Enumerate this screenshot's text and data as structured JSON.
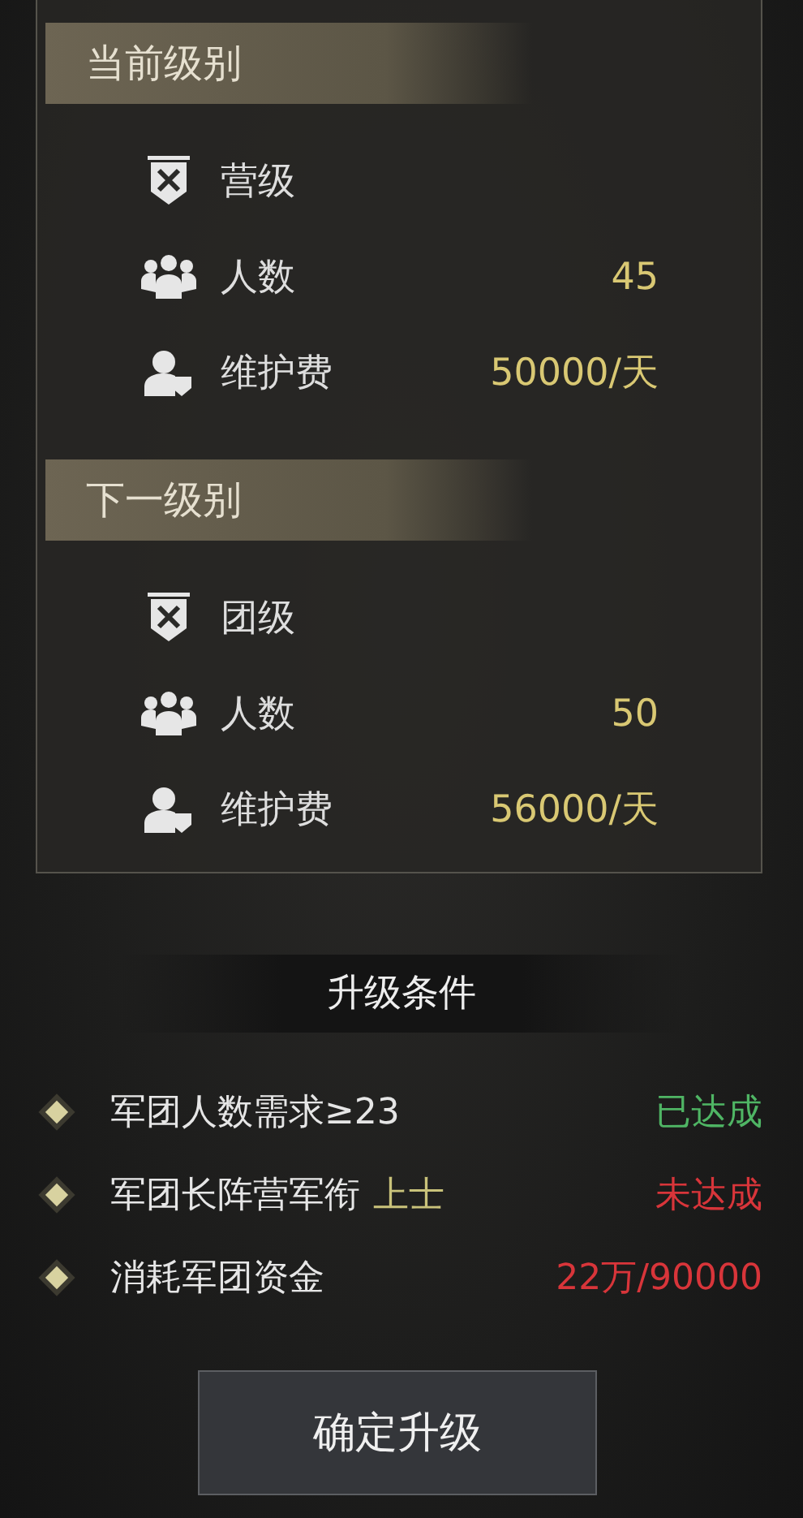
{
  "levels": [
    {
      "heading": "当前级别",
      "rows": [
        {
          "kind": "rank",
          "label": "营级"
        },
        {
          "kind": "members",
          "label": "人数",
          "value": "45"
        },
        {
          "kind": "upkeep",
          "label": "维护费",
          "value": "50000/天"
        }
      ]
    },
    {
      "heading": "下一级别",
      "rows": [
        {
          "kind": "rank",
          "label": "团级"
        },
        {
          "kind": "members",
          "label": "人数",
          "value": "50"
        },
        {
          "kind": "upkeep",
          "label": "维护费",
          "value": "56000/天"
        }
      ]
    }
  ],
  "conditions": {
    "title": "升级条件",
    "items": [
      {
        "label": "军团人数需求≥23",
        "status": "已达成",
        "met": true
      },
      {
        "label": "军团长阵营军衔",
        "highlight": "上士",
        "status": "未达成",
        "met": false
      },
      {
        "label": "消耗军团资金",
        "status": "22万/90000",
        "met": false
      }
    ]
  },
  "confirm_button": "确定升级"
}
